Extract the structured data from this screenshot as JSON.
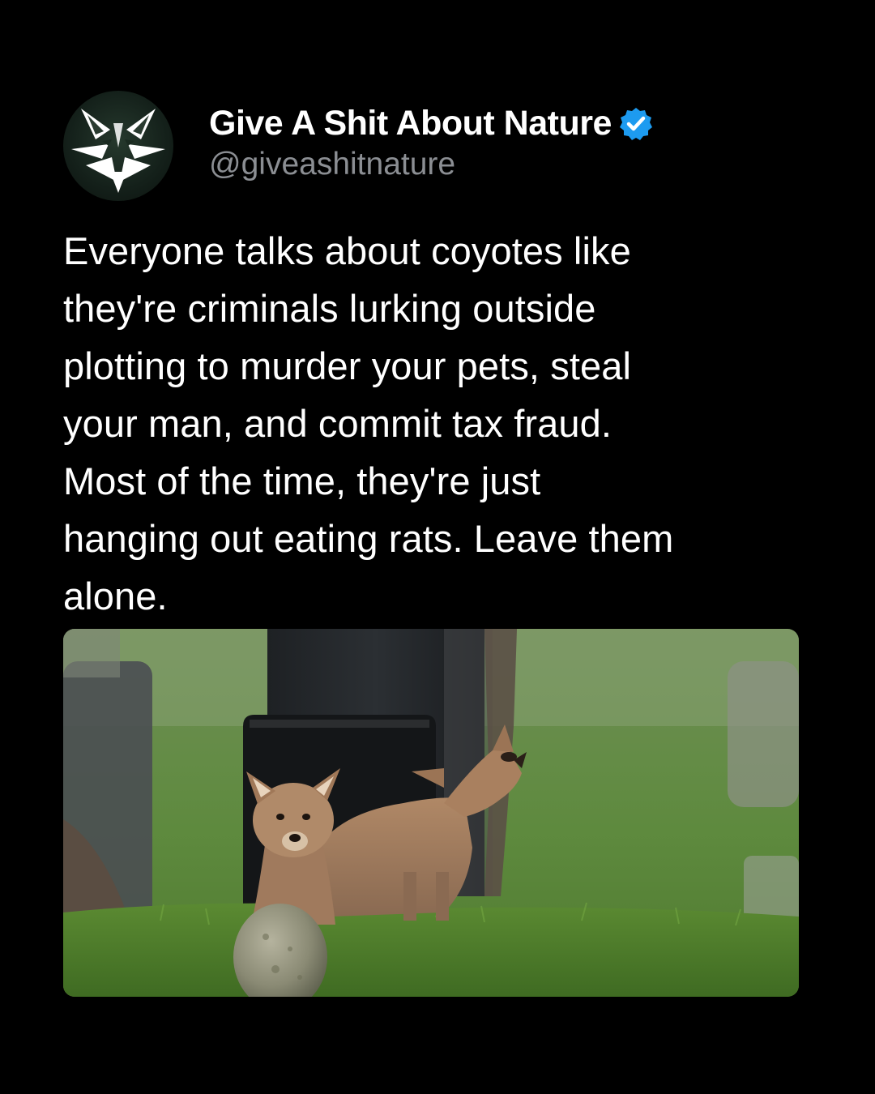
{
  "account": {
    "display_name": "Give A Shit About Nature",
    "handle": "@giveashitnature",
    "verified": true,
    "avatar_icon": "wolf-logo-icon",
    "verified_icon": "verified-badge-icon",
    "verified_color": "#1d9bf0"
  },
  "post": {
    "text": "Everyone talks about coyotes like\nthey're criminals lurking outside\nplotting to murder your pets, steal\nyour man, and commit tax fraud.\nMost of the time, they're just\nhanging out eating rats. Leave them\nalone."
  },
  "media": {
    "subject": "coyote pups in a cemetery"
  },
  "colors": {
    "background": "#000000",
    "text": "#ffffff",
    "handle": "#8b8e93"
  }
}
